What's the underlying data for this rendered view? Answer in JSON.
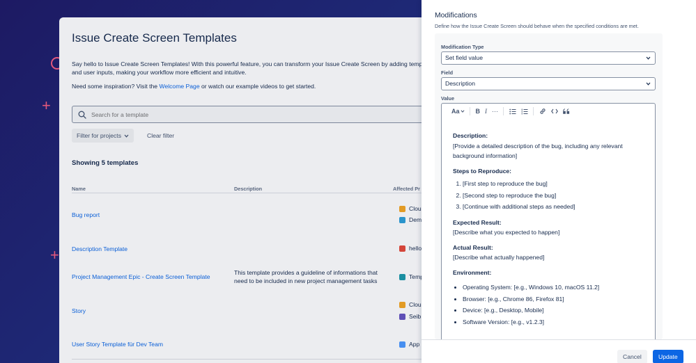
{
  "main": {
    "title": "Issue Create Screen Templates",
    "intro_line1": "Say hello to Issue Create Screen Templates! With this powerful feature, you can transform your Issue Create Screen by adding templates",
    "intro_line2": "and user inputs, making your workflow more efficient and intuitive.",
    "inspiration_prefix": "Need some inspiration? Visit the",
    "inspiration_link": "Welcome Page",
    "inspiration_suffix": "or watch our example videos to get started.",
    "search_placeholder": "Search for a template",
    "filter_label": "Filter for projects",
    "clear_label": "Clear filter",
    "showing": "Showing 5 templates",
    "columns": [
      "Name",
      "Description",
      "Affected Pr"
    ],
    "rows": [
      {
        "name": "Bug report",
        "description": "",
        "projects": [
          {
            "label": "Clou",
            "color": "#f5a623"
          },
          {
            "label": "Dem",
            "color": "#2d9fd8"
          }
        ]
      },
      {
        "name": "Description Template",
        "description": "",
        "projects": [
          {
            "label": "hello",
            "color": "#e5493a"
          }
        ]
      },
      {
        "name": "Project Management Epic - Create Screen Template",
        "description_line1": "This template provides a guideline of informations that",
        "description_line2": "need to be included in new project management tasks",
        "projects": [
          {
            "label": "Temp",
            "color": "#1d9aaa"
          }
        ]
      },
      {
        "name": "Story",
        "description": "",
        "projects": [
          {
            "label": "Clou",
            "color": "#f5a623"
          },
          {
            "label": "Seib",
            "color": "#6554c0"
          }
        ]
      },
      {
        "name": "User Story Template für Dev Team",
        "description": "",
        "projects": [
          {
            "label": "App",
            "color": "#4c9aff"
          }
        ]
      }
    ]
  },
  "drawer": {
    "title": "Modifications",
    "subtitle": "Define how the Issue Create Screen should behave when the specified conditions are met.",
    "modification_type_label": "Modification Type",
    "modification_type_value": "Set field value",
    "field_label": "Field",
    "field_value": "Description",
    "value_label": "Value",
    "toolbar": {
      "text_style": "Aa",
      "bold": "B",
      "italic": "I",
      "more": "···"
    },
    "content": {
      "h_description": "Description:",
      "p_description_1": "[Provide a detailed description of the bug, including any relevant",
      "p_description_2": "background information]",
      "h_steps": "Steps to Reproduce:",
      "steps": [
        "[First step to reproduce the bug]",
        "[Second step to reproduce the bug]",
        "[Continue with additional steps as needed]"
      ],
      "h_expected": "Expected Result:",
      "p_expected": "[Describe what you expected to happen]",
      "h_actual": "Actual Result:",
      "p_actual": "[Describe what actually happened]",
      "h_environment": "Environment:",
      "environment": [
        "Operating System: [e.g., Windows 10, macOS 11.2]",
        "Browser: [e.g., Chrome 86, Firefox 81]",
        "Device: [e.g., Desktop, Mobile]",
        "Software Version: [e.g., v1.2.3]"
      ]
    },
    "cancel_label": "Cancel",
    "update_label": "Update"
  },
  "colors": {
    "accent": "#0c66e4",
    "text": "#172b4d",
    "brand_deco": "#e2587c"
  }
}
